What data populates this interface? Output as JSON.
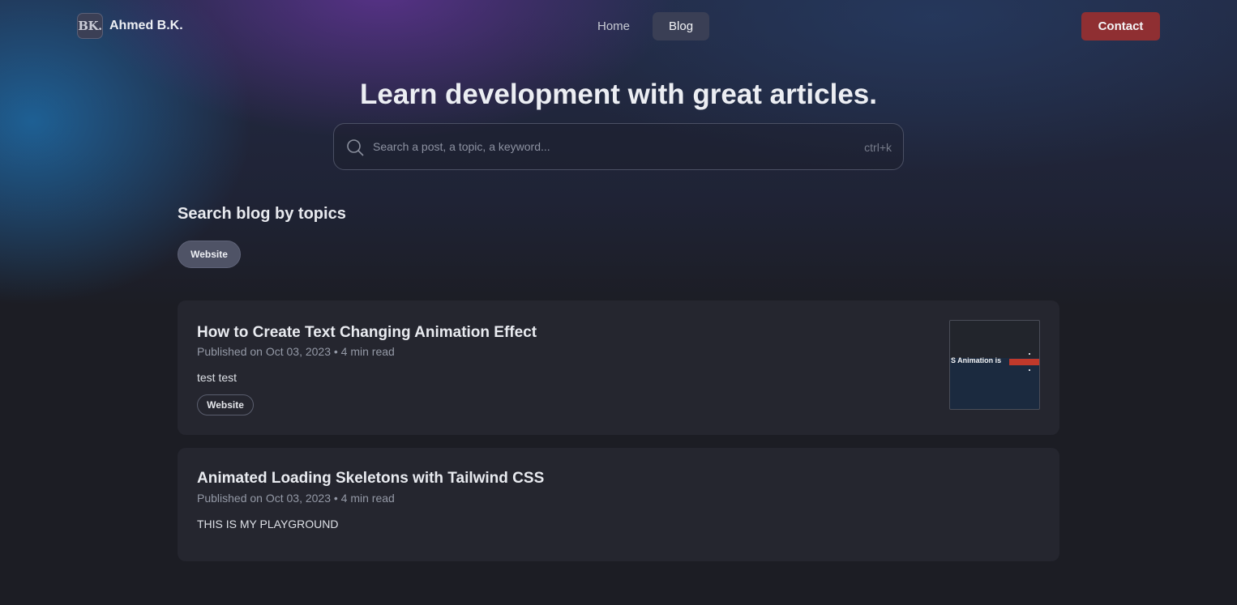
{
  "header": {
    "logo_text": "BK.",
    "brand_name": "Ahmed B.K.",
    "nav": [
      {
        "label": "Home"
      },
      {
        "label": "Blog"
      }
    ],
    "contact_label": "Contact"
  },
  "hero": {
    "title": "Learn development with great articles.",
    "search_placeholder": "Search a post, a topic, a keyword...",
    "search_shortcut": "ctrl+k"
  },
  "topics": {
    "title": "Search blog by topics",
    "items": [
      "Website"
    ]
  },
  "posts": [
    {
      "title": "How to Create Text Changing Animation Effect",
      "meta": "Published on Oct 03, 2023 • 4 min read",
      "description": "test test",
      "tag": "Website",
      "thumbnail_text": "S Animation is"
    },
    {
      "title": "Animated Loading Skeletons with Tailwind CSS",
      "meta": "Published on Oct 03, 2023 • 4 min read",
      "description": "THIS IS MY PLAYGROUND"
    }
  ],
  "colors": {
    "accent_button": "#8f2f32",
    "card_background": "#25262f",
    "page_background": "#1c1d24"
  }
}
